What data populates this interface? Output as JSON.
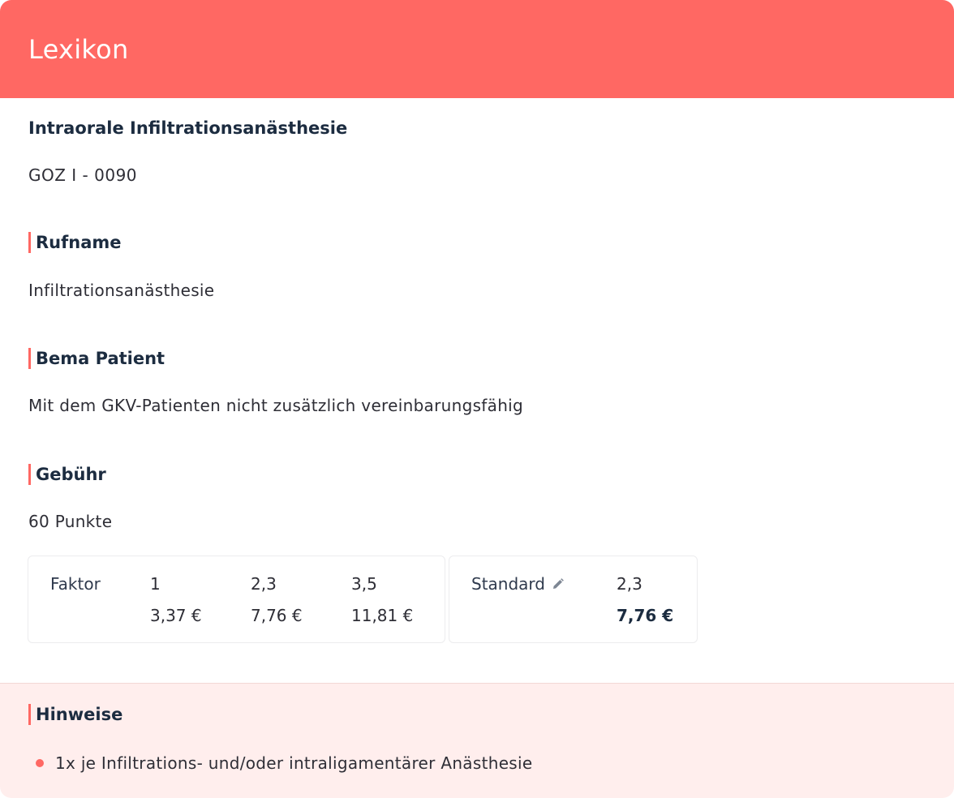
{
  "header": {
    "title": "Lexikon"
  },
  "entry": {
    "title": "Intraorale Infiltrationsanästhesie",
    "code": "GOZ I - 0090"
  },
  "sections": {
    "rufname": {
      "heading": "Rufname",
      "text": "Infiltrationsanästhesie"
    },
    "bema": {
      "heading": "Bema Patient",
      "text": "Mit dem GKV-Patienten nicht zusätzlich vereinbarungsfähig"
    },
    "gebuehr": {
      "heading": "Gebühr",
      "text": "60 Punkte"
    }
  },
  "fees": {
    "factor_label": "Faktor",
    "factors": [
      "1",
      "2,3",
      "3,5"
    ],
    "amounts": [
      "3,37 €",
      "7,76 €",
      "11,81 €"
    ],
    "standard": {
      "label": "Standard",
      "factor": "2,3",
      "amount": "7,76 €",
      "icon": "pencil-icon"
    }
  },
  "notes": {
    "heading": "Hinweise",
    "items": [
      "1x je Infiltrations- und/oder intraligamentärer Anästhesie"
    ]
  },
  "colors": {
    "accent": "#ff6863",
    "heading": "#1c2c40",
    "notes_bg": "#ffeeed"
  }
}
